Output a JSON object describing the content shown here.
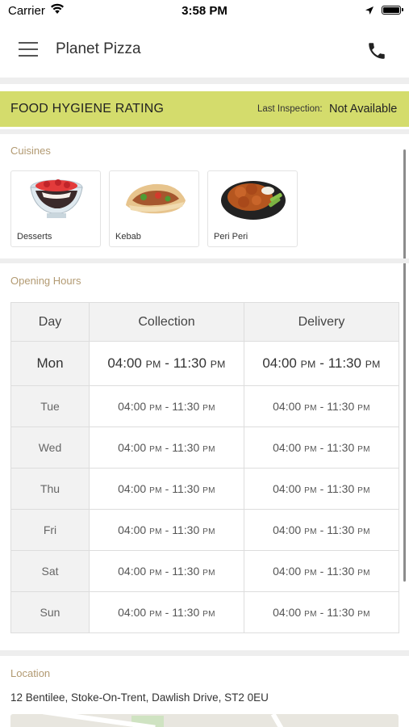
{
  "status_bar": {
    "carrier": "Carrier",
    "time": "3:58 PM"
  },
  "nav": {
    "title": "Planet Pizza"
  },
  "hygiene": {
    "title": "FOOD HYGIENE RATING",
    "last_inspection_label": "Last Inspection:",
    "last_inspection_value": "Not Available"
  },
  "cuisines": {
    "label": "Cuisines",
    "items": [
      {
        "name": "Desserts"
      },
      {
        "name": "Kebab"
      },
      {
        "name": "Peri Peri"
      }
    ]
  },
  "opening_hours": {
    "label": "Opening Hours",
    "headers": [
      "Day",
      "Collection",
      "Delivery"
    ],
    "rows": [
      {
        "day": "Mon",
        "collection": {
          "from": "04:00",
          "from_ampm": "PM",
          "to": "11:30",
          "to_ampm": "PM"
        },
        "delivery": {
          "from": "04:00",
          "from_ampm": "PM",
          "to": "11:30",
          "to_ampm": "PM"
        }
      },
      {
        "day": "Tue",
        "collection": {
          "from": "04:00",
          "from_ampm": "PM",
          "to": "11:30",
          "to_ampm": "PM"
        },
        "delivery": {
          "from": "04:00",
          "from_ampm": "PM",
          "to": "11:30",
          "to_ampm": "PM"
        }
      },
      {
        "day": "Wed",
        "collection": {
          "from": "04:00",
          "from_ampm": "PM",
          "to": "11:30",
          "to_ampm": "PM"
        },
        "delivery": {
          "from": "04:00",
          "from_ampm": "PM",
          "to": "11:30",
          "to_ampm": "PM"
        }
      },
      {
        "day": "Thu",
        "collection": {
          "from": "04:00",
          "from_ampm": "PM",
          "to": "11:30",
          "to_ampm": "PM"
        },
        "delivery": {
          "from": "04:00",
          "from_ampm": "PM",
          "to": "11:30",
          "to_ampm": "PM"
        }
      },
      {
        "day": "Fri",
        "collection": {
          "from": "04:00",
          "from_ampm": "PM",
          "to": "11:30",
          "to_ampm": "PM"
        },
        "delivery": {
          "from": "04:00",
          "from_ampm": "PM",
          "to": "11:30",
          "to_ampm": "PM"
        }
      },
      {
        "day": "Sat",
        "collection": {
          "from": "04:00",
          "from_ampm": "PM",
          "to": "11:30",
          "to_ampm": "PM"
        },
        "delivery": {
          "from": "04:00",
          "from_ampm": "PM",
          "to": "11:30",
          "to_ampm": "PM"
        }
      },
      {
        "day": "Sun",
        "collection": {
          "from": "04:00",
          "from_ampm": "PM",
          "to": "11:30",
          "to_ampm": "PM"
        },
        "delivery": {
          "from": "04:00",
          "from_ampm": "PM",
          "to": "11:30",
          "to_ampm": "PM"
        }
      }
    ]
  },
  "location": {
    "label": "Location",
    "address": "12 Bentilee, Stoke-On-Trent, Dawlish Drive, ST2 0EU"
  },
  "colors": {
    "hygiene_bar": "#d4dc6c",
    "section_label": "#b29a72",
    "table_header_bg": "#f2f2f2"
  }
}
